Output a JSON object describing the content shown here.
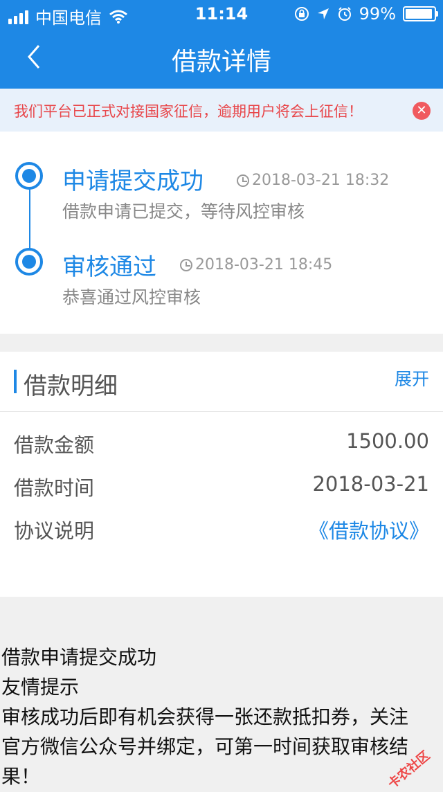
{
  "status": {
    "carrier": "中国电信",
    "time": "11:14",
    "battery": "99%"
  },
  "nav": {
    "title": "借款详情"
  },
  "notice": {
    "text": "我们平台已正式对接国家征信，逾期用户将会上征信！",
    "close": "✕"
  },
  "timeline": [
    {
      "title": "申请提交成功",
      "time": "2018-03-21 18:32",
      "desc": "借款申请已提交，等待风控审核"
    },
    {
      "title": "审核通过",
      "time": "2018-03-21 18:45",
      "desc": "恭喜通过风控审核"
    }
  ],
  "detail": {
    "title": "借款明细",
    "expand": "展开",
    "rows": [
      {
        "label": "借款金额",
        "value": "1500.00"
      },
      {
        "label": "借款时间",
        "value": "2018-03-21"
      },
      {
        "label": "协议说明",
        "value": "《借款协议》"
      }
    ]
  },
  "footer": {
    "lines": [
      "借款申请提交成功",
      "友情提示",
      "审核成功后即有机会获得一张还款抵扣券，关注",
      "官方微信公众号并绑定，可第一时间获取审核结",
      "果！"
    ]
  },
  "watermark": "卡农社区",
  "colors": {
    "primary": "#1e88e5",
    "alert": "#e8464a"
  }
}
